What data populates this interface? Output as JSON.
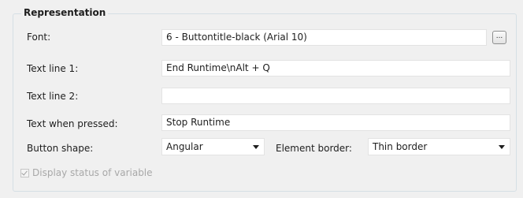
{
  "group": {
    "title": "Representation"
  },
  "font": {
    "label": "Font:",
    "value": "6 - Buttontitle-black (Arial 10)",
    "browse_label": "..."
  },
  "text_line_1": {
    "label": "Text line 1:",
    "value": "End Runtime\\nAlt + Q"
  },
  "text_line_2": {
    "label": "Text line 2:",
    "value": ""
  },
  "text_pressed": {
    "label": "Text when pressed:",
    "value": "Stop Runtime"
  },
  "button_shape": {
    "label": "Button shape:",
    "value": "Angular"
  },
  "element_border": {
    "label": "Element border:",
    "value": "Thin border"
  },
  "display_status": {
    "label": "Display status of variable",
    "checked": true,
    "enabled": false
  }
}
